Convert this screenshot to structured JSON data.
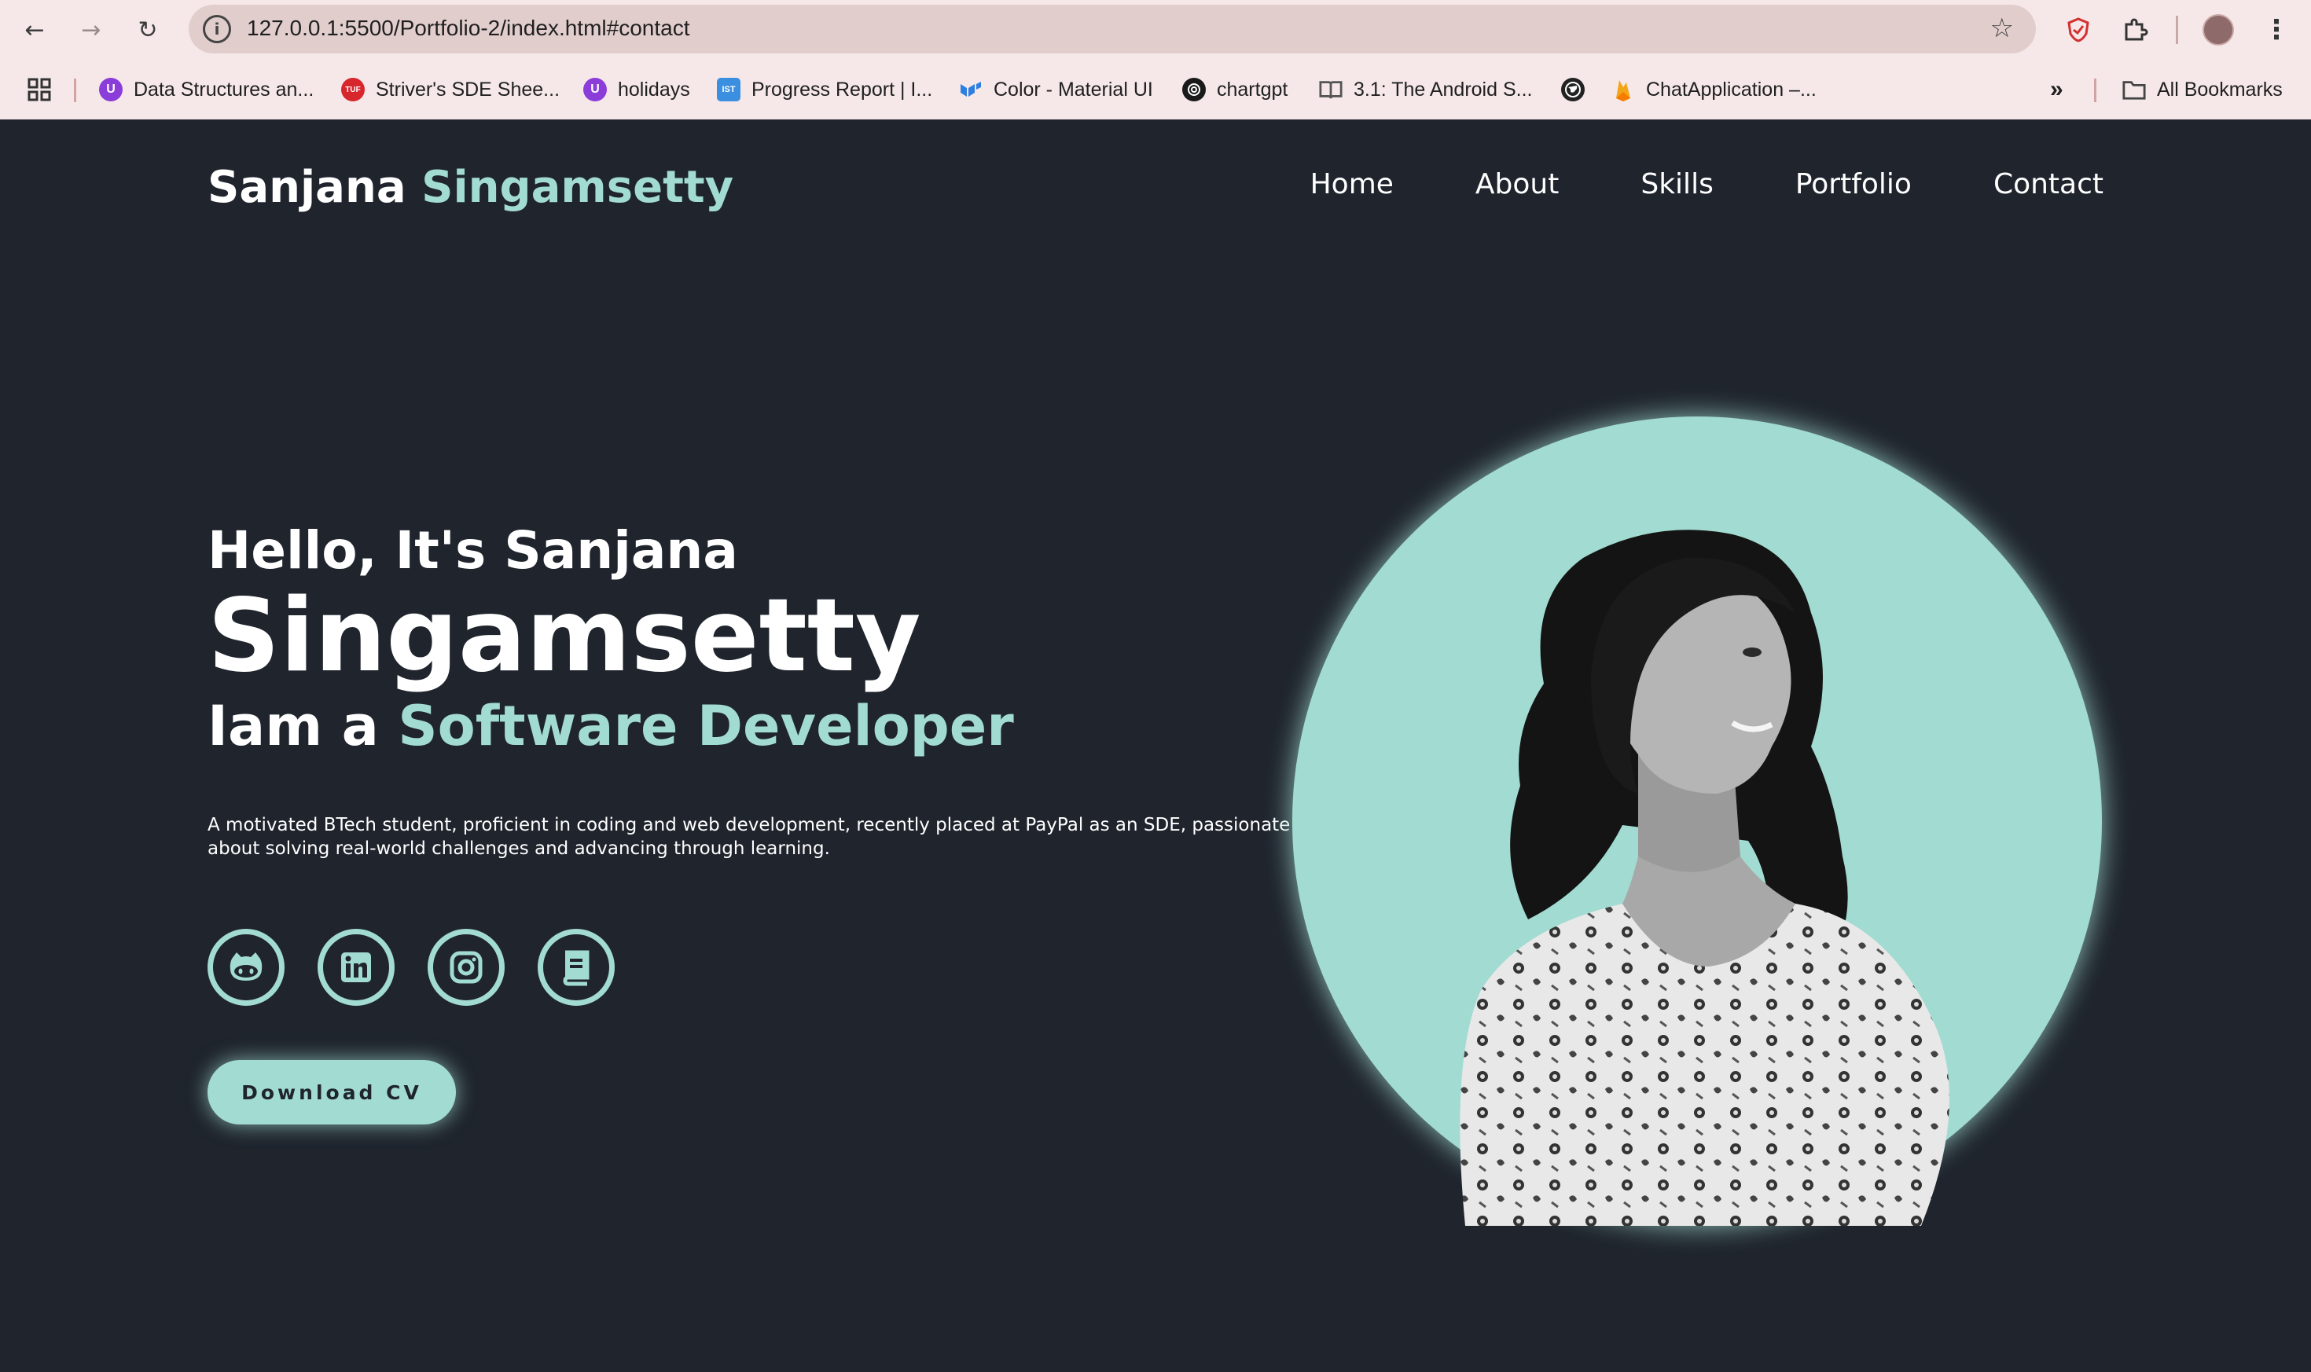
{
  "browser": {
    "url": "127.0.0.1:5500/Portfolio-2/index.html#contact",
    "bookmarks": [
      {
        "label": "Data Structures an...",
        "icon": "u-icon",
        "color": "#8b3dd9"
      },
      {
        "label": "Striver's SDE Shee...",
        "icon": "tuf-icon",
        "color": "#d8262d"
      },
      {
        "label": "holidays",
        "icon": "u-icon",
        "color": "#8b3dd9"
      },
      {
        "label": "Progress Report | I...",
        "icon": "ist-icon",
        "color": "#3b8fe0"
      },
      {
        "label": "Color - Material UI",
        "icon": "mui-icon",
        "color": "#2f7fe0"
      },
      {
        "label": "chartgpt",
        "icon": "openai-icon",
        "color": "#1a1a1a"
      },
      {
        "label": "3.1: The Android S...",
        "icon": "book-icon",
        "color": "#555555"
      },
      {
        "label": "",
        "icon": "globe-icon",
        "color": "#222222"
      },
      {
        "label": "ChatApplication –...",
        "icon": "firebase-icon",
        "color": "#f2a516"
      }
    ],
    "all_bookmarks": "All Bookmarks",
    "overflow": "»"
  },
  "site": {
    "logo_first": "Sanjana",
    "logo_second": "Singamsetty",
    "nav": [
      "Home",
      "About",
      "Skills",
      "Portfolio",
      "Contact"
    ],
    "accent_color": "#a2dbd1",
    "bg_color": "#1f242d"
  },
  "hero": {
    "hello": "Hello, It's Sanjana",
    "name": "Singamsetty",
    "role_prefix": "Iam a",
    "role": "Software Developer",
    "description": "A motivated BTech student, proficient in coding and web development, recently placed at PayPal as an SDE, passionate about solving real-world challenges and advancing through learning.",
    "socials": [
      "github-icon",
      "linkedin-icon",
      "instagram-icon",
      "book-icon"
    ],
    "cv_button": "Download CV"
  }
}
